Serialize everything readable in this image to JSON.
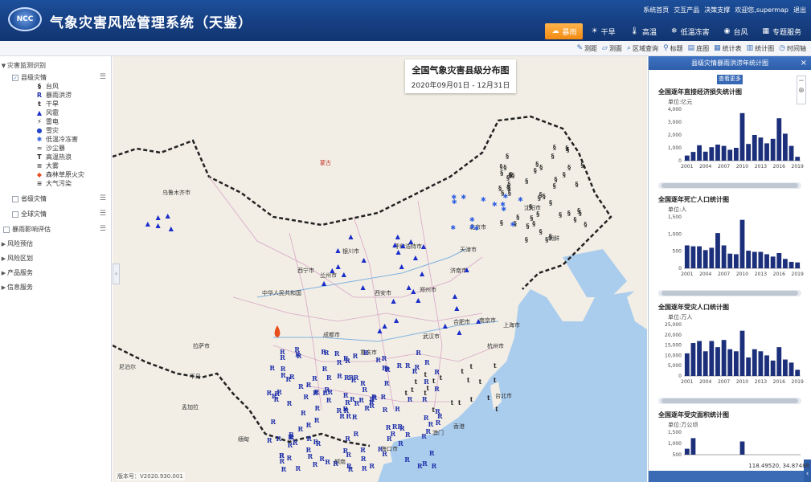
{
  "header": {
    "logo_text": "NCC",
    "title": "气象灾害风险管理系统（天鉴）",
    "links": [
      "系统首页",
      "交互产品",
      "决策支撑",
      "欢迎您,supermap",
      "退出"
    ],
    "nav": [
      {
        "label": "暴雨",
        "icon": "rain-cloud-icon",
        "active": true
      },
      {
        "label": "干旱",
        "icon": "drought-icon",
        "active": false
      },
      {
        "label": "高温",
        "icon": "heat-icon",
        "active": false
      },
      {
        "label": "低温冻害",
        "icon": "cold-icon",
        "active": false
      },
      {
        "label": "台风",
        "icon": "typhoon-icon",
        "active": false
      },
      {
        "label": "专题服务",
        "icon": "grid-icon",
        "active": false
      }
    ]
  },
  "toolbar": {
    "items": [
      "测距",
      "测面",
      "区域查询",
      "标题",
      "底图",
      "统计表",
      "统计图",
      "时间轴"
    ]
  },
  "sidebar": {
    "root_label": "灾害监测识别",
    "county_label": "县级灾情",
    "legend": [
      {
        "symbol": "§",
        "label": "台风",
        "color": "#222222"
      },
      {
        "symbol": "R",
        "label": "暴雨洪涝",
        "color": "#2233aa"
      },
      {
        "symbol": "t",
        "label": "干旱",
        "color": "#222222"
      },
      {
        "symbol": "▲",
        "label": "风雹",
        "color": "#1a2cc9"
      },
      {
        "symbol": "⚡",
        "label": "雷电",
        "color": "#222222"
      },
      {
        "symbol": "●",
        "label": "雪灾",
        "color": "#2244cc"
      },
      {
        "symbol": "✱",
        "label": "低温冷冻害",
        "color": "#2e5ee0"
      },
      {
        "symbol": "≈",
        "label": "沙尘暴",
        "color": "#555555"
      },
      {
        "symbol": "T",
        "label": "高温热浪",
        "color": "#222222"
      },
      {
        "symbol": "≡",
        "label": "大雾",
        "color": "#555555"
      },
      {
        "symbol": "◆",
        "label": "森林草原火灾",
        "color": "#e84d1c"
      },
      {
        "symbol": "≡",
        "label": "大气污染",
        "color": "#555555"
      }
    ],
    "province_label": "省级灾情",
    "global_label": "全球灾情",
    "impact_label": "暴雨影响评估",
    "groups": [
      "风险预估",
      "风险区划",
      "产品服务",
      "信息服务"
    ]
  },
  "map": {
    "title": "全国气象灾害县级分布图",
    "date_range": "2020年09月01日 - 12月31日",
    "version": "版本号：V2020.930.001",
    "coords": "118.49520, 34.87488",
    "places": [
      {
        "name": "乌鲁木齐市",
        "x": 62,
        "y": 165,
        "red": false
      },
      {
        "name": "蒙古",
        "x": 258,
        "y": 128,
        "red": true
      },
      {
        "name": "呼和浩特市",
        "x": 350,
        "y": 232,
        "red": false
      },
      {
        "name": "北京市",
        "x": 444,
        "y": 208,
        "red": false
      },
      {
        "name": "天津市",
        "x": 432,
        "y": 236,
        "red": false
      },
      {
        "name": "沈阳市",
        "x": 512,
        "y": 184,
        "red": false
      },
      {
        "name": "朝鲜",
        "x": 542,
        "y": 222,
        "red": false
      },
      {
        "name": "银川市",
        "x": 286,
        "y": 238,
        "red": false
      },
      {
        "name": "西宁市",
        "x": 230,
        "y": 262,
        "red": false
      },
      {
        "name": "兰州市",
        "x": 258,
        "y": 268,
        "red": false
      },
      {
        "name": "中华人民共和国",
        "x": 186,
        "y": 290,
        "red": false
      },
      {
        "name": "西安市",
        "x": 326,
        "y": 290,
        "red": false
      },
      {
        "name": "郑州市",
        "x": 382,
        "y": 286,
        "red": false
      },
      {
        "name": "济南市",
        "x": 420,
        "y": 262,
        "red": false
      },
      {
        "name": "南京市",
        "x": 456,
        "y": 324,
        "red": false
      },
      {
        "name": "合肥市",
        "x": 424,
        "y": 326,
        "red": false
      },
      {
        "name": "上海市",
        "x": 486,
        "y": 330,
        "red": false
      },
      {
        "name": "武汉市",
        "x": 386,
        "y": 344,
        "red": false
      },
      {
        "name": "杭州市",
        "x": 466,
        "y": 356,
        "red": false
      },
      {
        "name": "成都市",
        "x": 262,
        "y": 342,
        "red": false
      },
      {
        "name": "重庆市",
        "x": 308,
        "y": 364,
        "red": false
      },
      {
        "name": "拉萨市",
        "x": 100,
        "y": 356,
        "red": false
      },
      {
        "name": "尼泊尔",
        "x": 8,
        "y": 382,
        "red": false
      },
      {
        "name": "不丹",
        "x": 96,
        "y": 394,
        "red": false
      },
      {
        "name": "台北市",
        "x": 476,
        "y": 418,
        "red": false
      },
      {
        "name": "香港",
        "x": 424,
        "y": 456,
        "red": false
      },
      {
        "name": "澳门",
        "x": 398,
        "y": 464,
        "red": false
      },
      {
        "name": "海口市",
        "x": 334,
        "y": 484,
        "red": false
      },
      {
        "name": "孟加拉",
        "x": 86,
        "y": 432,
        "red": false
      },
      {
        "name": "缅甸",
        "x": 156,
        "y": 472,
        "red": false
      },
      {
        "name": "越南",
        "x": 276,
        "y": 500,
        "red": false
      }
    ]
  },
  "panel": {
    "title": "县级灾情暴雨洪涝年统计图",
    "more_label": "查看更多",
    "x_ticks": [
      "2001",
      "2004",
      "2007",
      "2010",
      "2013",
      "2016",
      "2019"
    ],
    "charts": [
      {
        "title": "全国逐年直接经济损失统计图",
        "unit": "单位:亿元",
        "y_ticks": [
          "4,000",
          "3,000",
          "2,000",
          "1,000",
          "0"
        ],
        "ymax": 4000,
        "years": [
          2001,
          2002,
          2003,
          2004,
          2005,
          2006,
          2007,
          2008,
          2009,
          2010,
          2011,
          2012,
          2013,
          2014,
          2015,
          2016,
          2017,
          2018,
          2019
        ],
        "values": [
          400,
          680,
          1200,
          700,
          1050,
          1250,
          1150,
          850,
          1000,
          3700,
          1300,
          2000,
          1800,
          1350,
          1700,
          3300,
          2100,
          1150,
          300
        ]
      },
      {
        "title": "全国逐年死亡人口统计图",
        "unit": "单位:人",
        "y_ticks": [
          "1,500",
          "1,000",
          "500",
          "0"
        ],
        "ymax": 1750,
        "years": [
          2001,
          2002,
          2003,
          2004,
          2005,
          2006,
          2007,
          2008,
          2009,
          2010,
          2011,
          2012,
          2013,
          2014,
          2015,
          2016,
          2017,
          2018,
          2019
        ],
        "values": [
          780,
          750,
          750,
          620,
          700,
          1200,
          780,
          500,
          480,
          1650,
          600,
          560,
          560,
          480,
          400,
          520,
          320,
          220,
          200
        ]
      },
      {
        "title": "全国逐年受灾人口统计图",
        "unit": "单位:万人",
        "y_ticks": [
          "25,000",
          "20,000",
          "15,000",
          "10,000",
          "5,000",
          "0"
        ],
        "ymax": 25000,
        "years": [
          2001,
          2002,
          2003,
          2004,
          2005,
          2006,
          2007,
          2008,
          2009,
          2010,
          2011,
          2012,
          2013,
          2014,
          2015,
          2016,
          2017,
          2018,
          2019
        ],
        "values": [
          11000,
          16000,
          17000,
          12000,
          17000,
          14000,
          17500,
          13000,
          12000,
          22000,
          9000,
          13000,
          12000,
          10000,
          7500,
          14000,
          8000,
          6500,
          3000
        ]
      },
      {
        "title": "全国逐年受灾面积统计图",
        "unit": "单位:万公顷",
        "y_ticks": [
          "1,500",
          "1,000",
          "500"
        ],
        "ymax": 1700,
        "years": [
          2001,
          2002,
          2003,
          2004,
          2005,
          2006,
          2007,
          2008,
          2009,
          2010,
          2011,
          2012,
          2013,
          2014,
          2015,
          2016,
          2017,
          2018,
          2019
        ],
        "values": [
          450,
          1250,
          0,
          0,
          0,
          0,
          0,
          0,
          0,
          1000,
          0,
          0,
          0,
          0,
          0,
          0,
          0,
          0,
          0
        ]
      }
    ],
    "bar_color": "#1c2f7a"
  }
}
